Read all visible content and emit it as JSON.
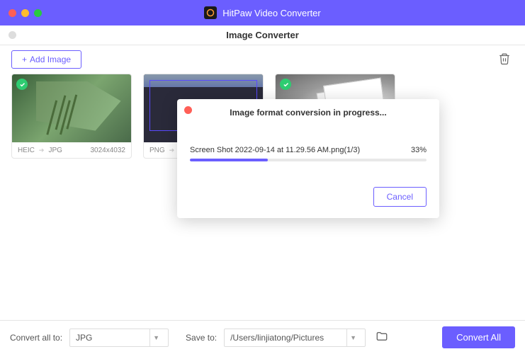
{
  "app": {
    "title": "HitPaw Video Converter"
  },
  "subwindow": {
    "title": "Image Converter"
  },
  "toolbar": {
    "add_image_label": "Add Image"
  },
  "cards": [
    {
      "from": "HEIC",
      "to": "JPG",
      "dimensions": "3024x4032",
      "checked": true
    },
    {
      "from": "PNG",
      "to": "",
      "dimensions": "",
      "checked": false
    },
    {
      "from": "",
      "to": "",
      "dimensions": "",
      "checked": true
    }
  ],
  "modal": {
    "title": "Image format conversion in progress...",
    "filename": "Screen Shot 2022-09-14 at 11.29.56 AM.png(1/3)",
    "percent_label": "33%",
    "percent_value": 33,
    "cancel_label": "Cancel"
  },
  "footer": {
    "convert_all_to_label": "Convert all to:",
    "convert_format": "JPG",
    "save_to_label": "Save to:",
    "save_path": "/Users/linjiatong/Pictures",
    "convert_all_btn": "Convert All"
  }
}
